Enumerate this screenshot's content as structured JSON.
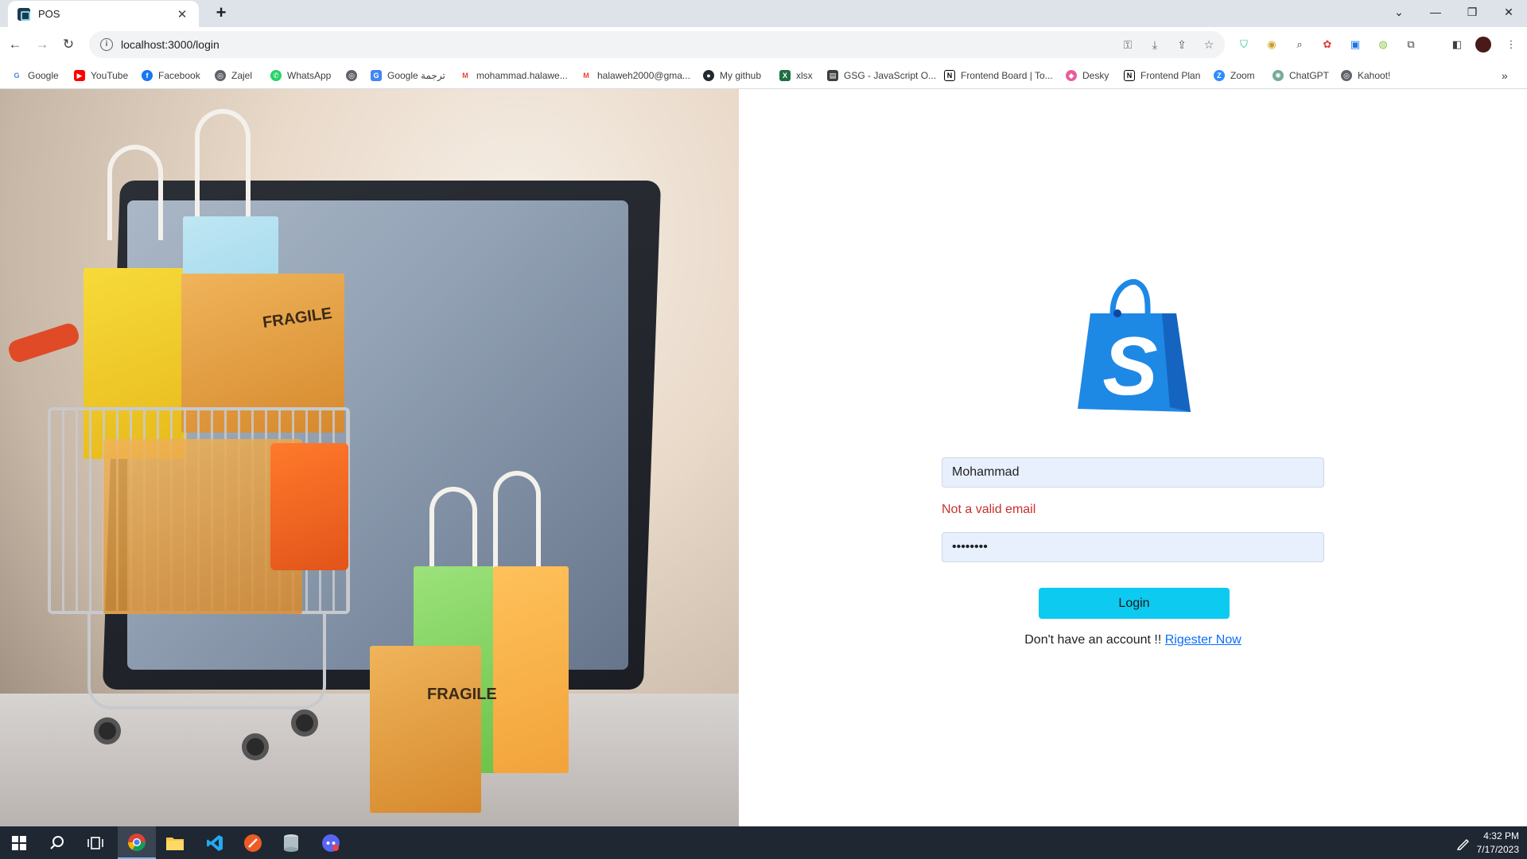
{
  "browser": {
    "tab_title": "POS",
    "url": "localhost:3000/login",
    "bookmarks": [
      {
        "label": "Google",
        "icon": "google-icon",
        "color": "#4285f4"
      },
      {
        "label": "YouTube",
        "icon": "youtube-icon",
        "color": "#ff0000"
      },
      {
        "label": "Facebook",
        "icon": "facebook-icon",
        "color": "#1877f2"
      },
      {
        "label": "Zajel",
        "icon": "globe-icon",
        "color": "#5f6368"
      },
      {
        "label": "WhatsApp",
        "icon": "whatsapp-icon",
        "color": "#25d366"
      },
      {
        "label": "",
        "icon": "globe-icon",
        "color": "#5f6368"
      },
      {
        "label": "Google ترجمة",
        "icon": "google-translate-icon",
        "color": "#4285f4"
      },
      {
        "label": "mohammad.halawe...",
        "icon": "gmail-icon",
        "color": "#ea4335"
      },
      {
        "label": "halaweh2000@gma...",
        "icon": "gmail-icon",
        "color": "#ea4335"
      },
      {
        "label": "My github",
        "icon": "github-icon",
        "color": "#24292e"
      },
      {
        "label": "xlsx",
        "icon": "excel-icon",
        "color": "#1d6f42"
      },
      {
        "label": "GSG - JavaScript O...",
        "icon": "document-icon",
        "color": "#3c4043"
      },
      {
        "label": "Frontend Board | To...",
        "icon": "notion-icon",
        "color": "#000000"
      },
      {
        "label": "Desky",
        "icon": "desky-icon",
        "color": "#e85d9c"
      },
      {
        "label": "Frontend Plan",
        "icon": "notion-icon",
        "color": "#000000"
      },
      {
        "label": "Zoom",
        "icon": "zoom-icon",
        "color": "#2d8cff"
      },
      {
        "label": "ChatGPT",
        "icon": "chatgpt-icon",
        "color": "#74aa9c"
      },
      {
        "label": "Kahoot!",
        "icon": "globe-icon",
        "color": "#5f6368"
      }
    ]
  },
  "login": {
    "username_value": "Mohammad",
    "error_text": "Not a valid email",
    "password_value": "••••••••",
    "login_button": "Login",
    "register_prompt": "Don't have an account !! ",
    "register_link": "Rigester Now"
  },
  "hero": {
    "box_label_1": "FRAGILE",
    "box_label_2": "FRAGILE"
  },
  "taskbar": {
    "time": "4:32 PM",
    "date": "7/17/2023"
  },
  "colors": {
    "accent_button": "#0dcaf0",
    "error": "#c9302c",
    "link": "#0d6efd",
    "logo_blue": "#1e88e5"
  }
}
